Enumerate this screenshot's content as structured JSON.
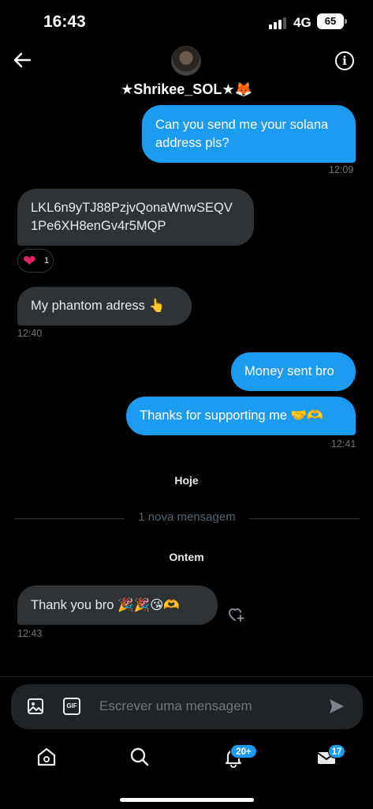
{
  "status_bar": {
    "time": "16:43",
    "network": "4G",
    "battery": "65"
  },
  "header": {
    "name": "★Shrikee_SOL★🦊"
  },
  "messages": [
    {
      "text": "Can you send me your solana address pls?",
      "time": "12:09"
    },
    {
      "text": "LKL6n9yTJ88PzjvQonaWnwSEQV1Pe6XH8enGv4r5MQP",
      "line1": "LKL6n9yTJ88PzjvQonaWnwSEQV",
      "line2": "1Pe6XH8enGv4r5MQP",
      "reaction": "❤",
      "reaction_count": "1"
    },
    {
      "text": "My phantom adress 👆",
      "time": "12:40"
    },
    {
      "text": "Money sent bro"
    },
    {
      "text": "Thanks for supporting me 🤝🫶",
      "time": "12:41"
    },
    {
      "text": "Thank you bro 🎉🎉😘🫶",
      "time": "12:43"
    }
  ],
  "dividers": {
    "today": "Hoje",
    "new_message": "1 nova mensagem",
    "yesterday": "Ontem"
  },
  "composer": {
    "placeholder": "Escrever uma mensagem"
  },
  "tabbar": {
    "notifications_badge": "20+",
    "messages_badge": "17"
  },
  "colors": {
    "accent": "#1d9bf0",
    "received_bubble": "#2f3336",
    "background": "#000000"
  },
  "icons": [
    "back-arrow-icon",
    "info-icon",
    "heart-icon",
    "add-reaction-icon",
    "image-icon",
    "gif-icon",
    "send-icon",
    "home-icon",
    "search-icon",
    "bell-icon",
    "mail-icon"
  ]
}
